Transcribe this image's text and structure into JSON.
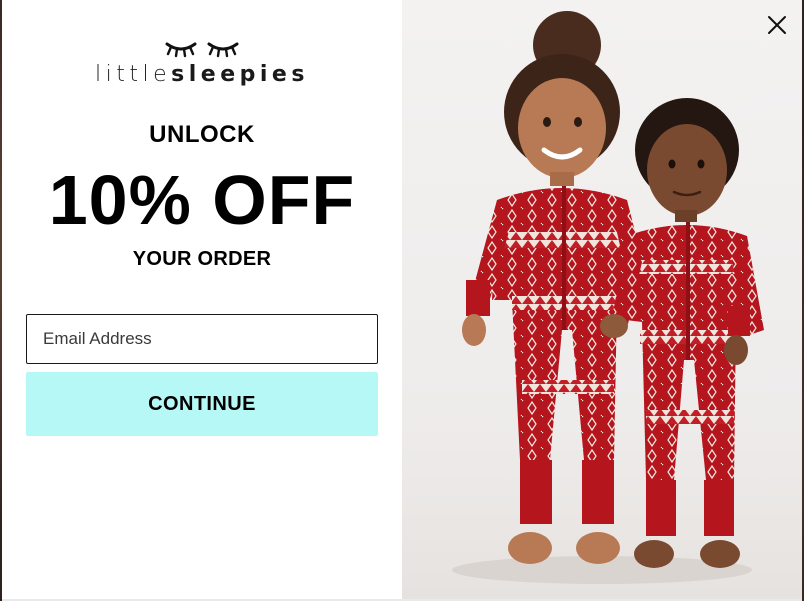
{
  "brand": {
    "name_light": "little",
    "name_bold": "sleepies"
  },
  "offer": {
    "kicker": "UNLOCK",
    "headline": "10% OFF",
    "subline": "YOUR ORDER"
  },
  "form": {
    "email_placeholder": "Email Address",
    "email_value": "",
    "submit_label": "CONTINUE"
  },
  "colors": {
    "button_bg": "#b6f8f6",
    "pajama_red": "#b5161e",
    "text": "#000000"
  },
  "icons": {
    "close": "close-icon",
    "logo": "sleepy-eyes-logo-icon"
  }
}
